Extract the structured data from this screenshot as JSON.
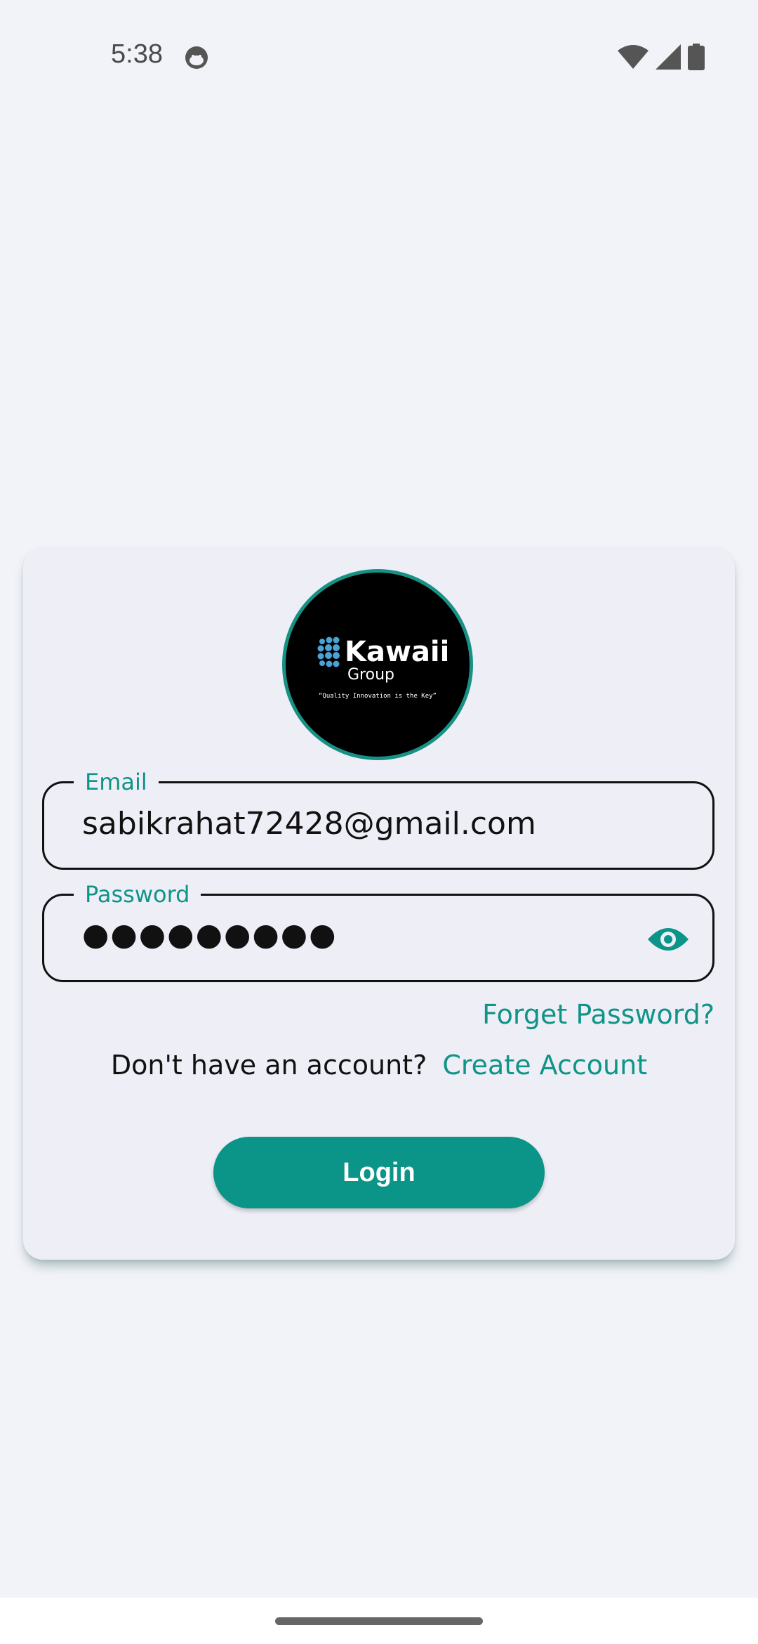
{
  "status_bar": {
    "time": "5:38",
    "app_icon": "cat-face-icon",
    "icons": [
      "wifi-icon",
      "signal-icon",
      "battery-icon"
    ]
  },
  "logo": {
    "brand_name": "Kawaii",
    "brand_sub": "Group",
    "tagline": "“Quality Innovation is the Key”"
  },
  "email": {
    "label": "Email",
    "value": "sabikrahat72428@gmail.com"
  },
  "password": {
    "label": "Password",
    "value": "●●●●●●●●●",
    "toggle_icon": "eye-icon"
  },
  "forgot_password": "Forget Password?",
  "signup": {
    "prompt": "Don't have an account?",
    "link": "Create Account"
  },
  "login_button": "Login",
  "colors": {
    "accent": "#0b9488",
    "background": "#f2f3f8",
    "card": "#eeeef6"
  }
}
